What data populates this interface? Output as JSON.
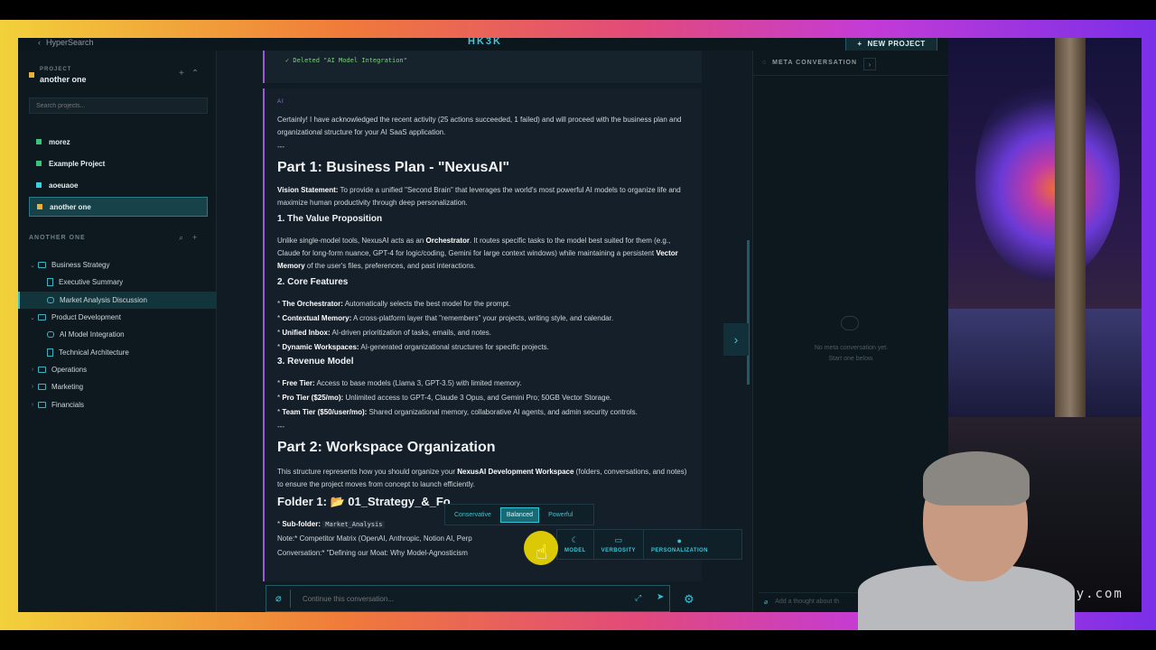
{
  "header": {
    "back_label": "HyperSearch",
    "logo": "HK3K",
    "new_project_label": "NEW PROJECT"
  },
  "sidebar": {
    "project_label": "PROJECT",
    "project_name": "another one",
    "search_placeholder": "Search projects...",
    "projects": [
      {
        "label": "morez",
        "color": "#3ac37a"
      },
      {
        "label": "Example Project",
        "color": "#3ac37a"
      },
      {
        "label": "aoeuaoe",
        "color": "#3ad0e0"
      },
      {
        "label": "another one",
        "color": "#e9b13a"
      }
    ],
    "section_label": "ANOTHER ONE",
    "tree": [
      {
        "label": "Business Strategy",
        "type": "folder"
      },
      {
        "label": "Executive Summary",
        "type": "doc"
      },
      {
        "label": "Market Analysis Discussion",
        "type": "chat"
      },
      {
        "label": "Product Development",
        "type": "folder"
      },
      {
        "label": "AI Model Integration",
        "type": "chat"
      },
      {
        "label": "Technical Architecture",
        "type": "doc"
      },
      {
        "label": "Operations",
        "type": "folder"
      },
      {
        "label": "Marketing",
        "type": "folder"
      },
      {
        "label": "Financials",
        "type": "folder"
      }
    ]
  },
  "chat": {
    "deleted_note": "✓ Deleted \"AI Model Integration\"",
    "ai_tag": "AI",
    "intro": "Certainly! I have acknowledged the recent activity (25 actions succeeded, 1 failed) and will proceed with the business plan and organizational structure for your AI SaaS application.",
    "sep": "---",
    "part1": "Part 1: Business Plan - \"NexusAI\"",
    "vision_label": "Vision Statement:",
    "vision_text": " To provide a unified \"Second Brain\" that leverages the world's most powerful AI models to organize life and maximize human productivity through deep personalization.",
    "h_value": "1. The Value Proposition",
    "value_a": "Unlike single-model tools, NexusAI acts as an ",
    "value_b": "Orchestrator",
    "value_c": ". It routes specific tasks to the model best suited for them (e.g., Claude for long-form nuance, GPT-4 for logic/coding, Gemini for large context windows) while maintaining a persistent ",
    "value_d": "Vector Memory",
    "value_e": " of the user's files, preferences, and past interactions.",
    "h_core": "2. Core Features",
    "features": [
      {
        "b": "The Orchestrator:",
        "t": " Automatically selects the best model for the prompt."
      },
      {
        "b": "Contextual Memory:",
        "t": " A cross-platform layer that \"remembers\" your projects, writing style, and calendar."
      },
      {
        "b": "Unified Inbox:",
        "t": " AI-driven prioritization of tasks, emails, and notes."
      },
      {
        "b": "Dynamic Workspaces:",
        "t": " AI-generated organizational structures for specific projects."
      }
    ],
    "h_rev": "3. Revenue Model",
    "tiers": [
      {
        "b": "Free Tier:",
        "t": " Access to base models (Llama 3, GPT-3.5) with limited memory."
      },
      {
        "b": "Pro Tier ($25/mo):",
        "t": " Unlimited access to GPT-4, Claude 3 Opus, and Gemini Pro; 50GB Vector Storage."
      },
      {
        "b": "Team Tier ($50/user/mo):",
        "t": " Shared organizational memory, collaborative AI agents, and admin security controls."
      }
    ],
    "sep2": "---",
    "part2": "Part 2: Workspace Organization",
    "ws_a": "This structure represents how you should organize your ",
    "ws_b": "NexusAI Development Workspace",
    "ws_c": " (folders, conversations, and notes) to ensure the project moves from concept to launch efficiently.",
    "folder1": "Folder 1: 📂 01_Strategy_&_Fo",
    "subfolder_label": "Sub-folder:",
    "subfolder_code": "Market_Analysis",
    "note_line": "Note:* Competitor Matrix (OpenAI, Anthropic, Notion AI, Perp",
    "conv_line": "Conversation:* \"Defining our Moat: Why Model-Agnosticism",
    "composer_placeholder": "Continue this conversation..."
  },
  "style_options": [
    "Conservative",
    "Balanced",
    "Powerful"
  ],
  "style_selected": "Balanced",
  "tools": [
    {
      "label": "MODEL",
      "icon": "model-icon"
    },
    {
      "label": "VERBOSITY",
      "icon": "verbosity-icon"
    },
    {
      "label": "PERSONALIZATION",
      "icon": "person-icon"
    }
  ],
  "meta": {
    "title": "META CONVERSATION",
    "empty_line1": "No meta conversation yet.",
    "empty_line2": "Start one below.",
    "input_placeholder": "Add a thought about th"
  },
  "watermark": "phemy.com",
  "colors": {
    "accent": "#3ac3d4",
    "purple": "#9b5bd6"
  }
}
